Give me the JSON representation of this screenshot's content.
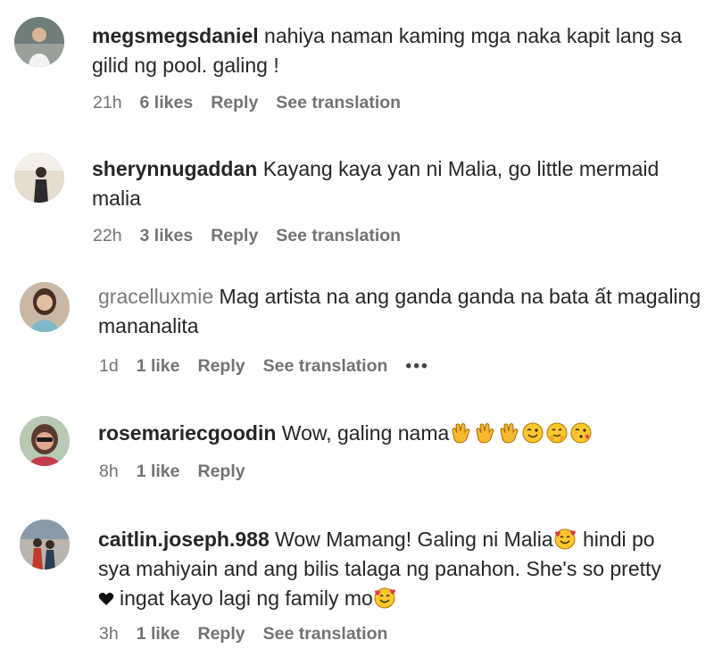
{
  "comments": [
    {
      "username": "megsmegsdaniel",
      "text": "nahiya naman kaming mga naka kapit lang sa gilid ng pool. galing !",
      "time": "21h",
      "likes": "6 likes",
      "reply": "Reply",
      "translation": "See translation",
      "avatar_icon": "user-avatar-photo"
    },
    {
      "username": "sherynnugaddan",
      "text": "Kayang kaya yan ni Malia, go little mermaid malia",
      "time": "22h",
      "likes": "3 likes",
      "reply": "Reply",
      "translation": "See translation",
      "avatar_icon": "user-avatar-photo"
    },
    {
      "username": "gracelluxmie",
      "text": "Mag artista na ang ganda ganda na bata ất magaling mananalita",
      "time": "1d",
      "likes": "1 like",
      "reply": "Reply",
      "translation": "See translation",
      "more": "•••",
      "avatar_icon": "user-avatar-photo"
    },
    {
      "username": "rosemariecgoodin",
      "text": "Wow, galing nama",
      "emojis": [
        "clapping-hands",
        "clapping-hands",
        "clapping-hands",
        "winking-face",
        "hugging-face",
        "kissing-face"
      ],
      "time": "8h",
      "likes": "1 like",
      "reply": "Reply",
      "avatar_icon": "user-avatar-photo"
    },
    {
      "username": "caitlin.joseph.988",
      "text_line1": "Wow Mamang! Galing ni Malia",
      "text_line1b": " hindi po",
      "text_line2": "sya mahiyain and ang bilis talaga ng panahon. She's so pretty",
      "text_line3": "ingat kayo lagi ng family mo",
      "time": "3h",
      "likes": "1 like",
      "reply": "Reply",
      "translation": "See translation",
      "avatar_icon": "user-avatar-photo"
    }
  ]
}
